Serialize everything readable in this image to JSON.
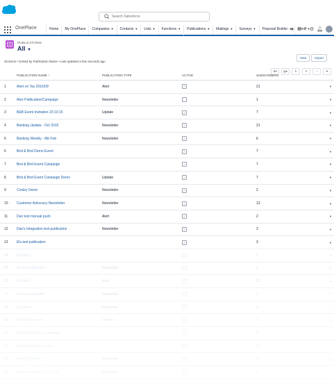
{
  "search": {
    "placeholder": "Search Salesforce"
  },
  "app": {
    "name": "OnePlace"
  },
  "tabs": [
    {
      "label": "Home",
      "menu": false
    },
    {
      "label": "My OnePlace",
      "menu": false
    },
    {
      "label": "Companies",
      "menu": true
    },
    {
      "label": "Contacts",
      "menu": true
    },
    {
      "label": "Lists",
      "menu": true
    },
    {
      "label": "Functions",
      "menu": true
    },
    {
      "label": "Publications",
      "menu": true,
      "active": true
    },
    {
      "label": "Mailings",
      "menu": true
    },
    {
      "label": "Surveys",
      "menu": true
    },
    {
      "label": "Proposal Builder",
      "menu": true
    },
    {
      "label": "More",
      "menu": true
    }
  ],
  "header": {
    "object_label": "PUBLICATIONS",
    "view_name": "All",
    "new_label": "New",
    "import_label": "Import"
  },
  "list_info": "26 items • Sorted by Publication Name • Last updated a few seconds ago",
  "columns": {
    "name": "PUBLICATION NAME",
    "type": "PUBLICATION TYPE",
    "active": "ACTIVE",
    "subscribers": "SUBSCRIBERS"
  },
  "rows": [
    {
      "num": "1",
      "name": "Alert on Tax 2016/09",
      "type": "Alert",
      "active": true,
      "subscribers": "21"
    },
    {
      "num": "2",
      "name": "Alex Publication/Campaign",
      "type": "Newsletter",
      "active": false,
      "subscribers": "1"
    },
    {
      "num": "3",
      "name": "B&B Event Invitation 23:10:15",
      "type": "Update",
      "active": true,
      "subscribers": "7"
    },
    {
      "num": "4",
      "name": "Banking Update - Oct 2015",
      "type": "Newsletter",
      "active": true,
      "subscribers": "21"
    },
    {
      "num": "5",
      "name": "Banking Weekly - 8th Feb",
      "type": "Newsletter",
      "active": true,
      "subscribers": "6"
    },
    {
      "num": "6",
      "name": "Bird & Bird Demo Event",
      "type": "",
      "active": true,
      "subscribers": "7"
    },
    {
      "num": "7",
      "name": "Bird & Bird Event Campaign",
      "type": "",
      "active": true,
      "subscribers": "7"
    },
    {
      "num": "8",
      "name": "Bird & Bird Event Campaign Demo",
      "type": "Update",
      "active": true,
      "subscribers": "7"
    },
    {
      "num": "9",
      "name": "Cooley Demo",
      "type": "Newsletter",
      "active": true,
      "subscribers": "2"
    },
    {
      "num": "10",
      "name": "Customer Advocacy Newsletter",
      "type": "Newsletter",
      "active": true,
      "subscribers": "13"
    },
    {
      "num": "11",
      "name": "Dan test manual push",
      "type": "Alert",
      "active": true,
      "subscribers": "2"
    },
    {
      "num": "12",
      "name": "Dan's Integration test publication",
      "type": "Newsletter",
      "active": true,
      "subscribers": "2"
    },
    {
      "num": "13",
      "name": "Els test publication",
      "type": "",
      "active": true,
      "subscribers": "3"
    }
  ],
  "faded_rows": [
    {
      "num": "14",
      "name": "Els test 2",
      "type": "",
      "active": true,
      "subscribers": "1"
    },
    {
      "num": "15",
      "name": "Els test publication",
      "type": "Newsletter",
      "active": true,
      "subscribers": "2"
    },
    {
      "num": "16",
      "name": "Els test 3",
      "type": "Alert",
      "active": true,
      "subscribers": "10"
    },
    {
      "num": "17",
      "name": "Els test newsletter",
      "type": "Newsletter",
      "active": true,
      "subscribers": "2"
    },
    {
      "num": "18",
      "name": "Els demo",
      "type": "Newsletter",
      "active": true,
      "subscribers": "3"
    },
    {
      "num": "19",
      "name": "Bird & Bird Event",
      "type": "Update",
      "active": true,
      "subscribers": "1"
    },
    {
      "num": "20",
      "name": "Bird & Bird Event Campaign",
      "type": "",
      "active": true,
      "subscribers": "2"
    },
    {
      "num": "21",
      "name": "Bird & Bird Demo Event",
      "type": "",
      "active": true,
      "subscribers": "13"
    },
    {
      "num": "22",
      "name": "Banking Weekly",
      "type": "Newsletter",
      "active": true,
      "subscribers": "2"
    },
    {
      "num": "23",
      "name": "Banking Update - Oct 2015",
      "type": "Newsletter",
      "active": true,
      "subscribers": "2"
    }
  ],
  "colors": {
    "brand_blue": "#1b5fa8",
    "link_blue": "#1b5fa8",
    "object_icon": "#b74dd1",
    "logo": "#00a1e0"
  }
}
